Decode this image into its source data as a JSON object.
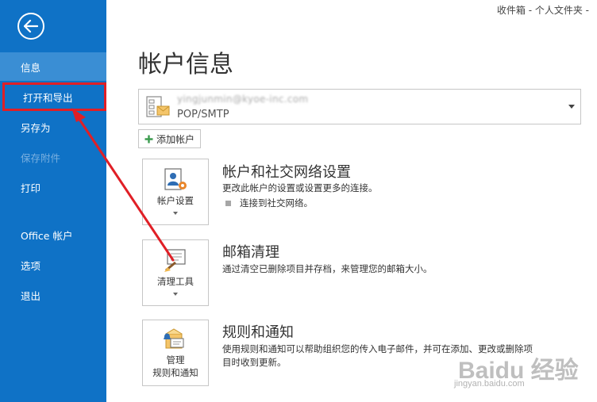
{
  "window": {
    "title": "收件箱 - 个人文件夹 -"
  },
  "sidebar": {
    "back_icon": "back-arrow-icon",
    "items": [
      {
        "label": "信息",
        "state": "active"
      },
      {
        "label": "打开和导出",
        "state": "highlighted"
      },
      {
        "label": "另存为",
        "state": "normal"
      },
      {
        "label": "保存附件",
        "state": "disabled"
      },
      {
        "label": "打印",
        "state": "normal"
      },
      {
        "label": "Office 帐户",
        "state": "normal"
      },
      {
        "label": "选项",
        "state": "normal"
      },
      {
        "label": "退出",
        "state": "normal"
      }
    ]
  },
  "main": {
    "title": "帐户信息",
    "account": {
      "email": "yingjunmin@kyoe-inc.com",
      "type": "POP/SMTP"
    },
    "add_account_label": "添加帐户",
    "sections": [
      {
        "button_label": "帐户设置",
        "title": "帐户和社交网络设置",
        "description": "更改此帐户的设置或设置更多的连接。",
        "bullet": "连接到社交网络。"
      },
      {
        "button_label": "清理工具",
        "title": "邮箱清理",
        "description": "通过清空已删除项目并存档，来管理您的邮箱大小。"
      },
      {
        "button_label_line1": "管理",
        "button_label_line2": "规则和通知",
        "title": "规则和通知",
        "description_line1": "使用规则和通知可以帮助组织您的传入电子邮件，并可在添加、更改或删除项",
        "description_line2": "目时收到更新。"
      }
    ]
  },
  "watermark": {
    "brand": "Baidu 经验",
    "url": "jingyan.baidu.com"
  },
  "colors": {
    "sidebar": "#0f72c6",
    "sidebar_active": "#3a8ed4",
    "annotation": "#e01f26"
  }
}
